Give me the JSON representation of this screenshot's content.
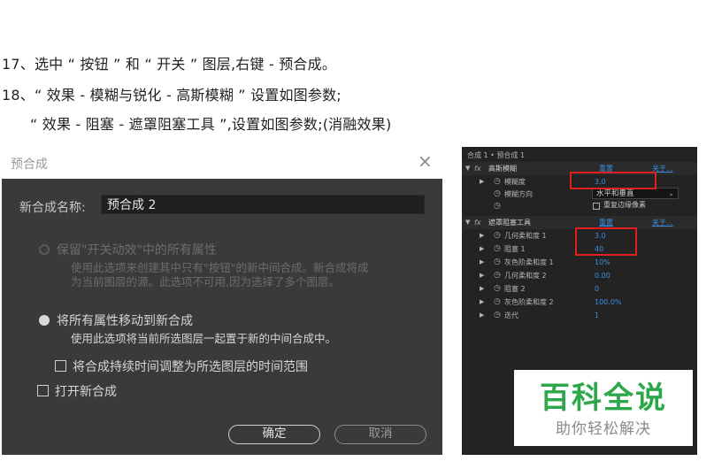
{
  "article": {
    "line1": "17、选中 “ 按钮 ” 和 “ 开关 ” 图层,右键 - 预合成。",
    "line2": "18、“ 效果 - 模糊与锐化 - 高斯模糊 ” 设置如图参数;",
    "line3": "“ 效果 - 阻塞 - 遮罩阻塞工具 ”,设置如图参数;(消融效果)"
  },
  "dialog": {
    "title": "预合成",
    "close_glyph": "×",
    "name_label": "新合成名称:",
    "name_value": "预合成 2",
    "option1_title": "保留\"开关动效\"中的所有属性",
    "option1_desc1": "使用此选项来创建其中只有\"按钮\"的新中间合成。新合成将成",
    "option1_desc2": "为当前图层的源。此选项不可用,因为选择了多个图层。",
    "option2_title": "将所有属性移动到新合成",
    "option2_desc": "使用此选项将当前所选图层一起置于新的中间合成中。",
    "check_adjust": "将合成持续时间调整为所选图层的时间范围",
    "check_open": "打开新合成",
    "ok": "确定",
    "cancel": "取消"
  },
  "effects_panel": {
    "breadcrumb": "合成 1 • 预合成 1",
    "gaussian": {
      "name": "高斯模糊",
      "reset": "重置",
      "about": "关于...",
      "blurriness_label": "模糊度",
      "blurriness_value": "3.0",
      "direction_label": "模糊方向",
      "direction_value": "水平和垂直",
      "repeat_edge": "重复边缘像素"
    },
    "matte_choker": {
      "name": "遮罩阻塞工具",
      "reset": "重置",
      "about": "关于...",
      "params": [
        {
          "label": "几何柔和度 1",
          "value": "3.0"
        },
        {
          "label": "阻塞 1",
          "value": "40"
        },
        {
          "label": "灰色阶柔和度 1",
          "value": "10%"
        },
        {
          "label": "几何柔和度 2",
          "value": "0.00"
        },
        {
          "label": "阻塞 2",
          "value": "0"
        },
        {
          "label": "灰色阶柔和度 2",
          "value": "100.0%"
        },
        {
          "label": "迭代",
          "value": "1"
        }
      ]
    }
  },
  "watermark": {
    "brand": "百科全说",
    "slogan": "助你轻松解决"
  },
  "colors": {
    "highlight_box": "#e02020",
    "value_blue": "#3a8fe0",
    "watermark_green": "#2ca84a"
  }
}
